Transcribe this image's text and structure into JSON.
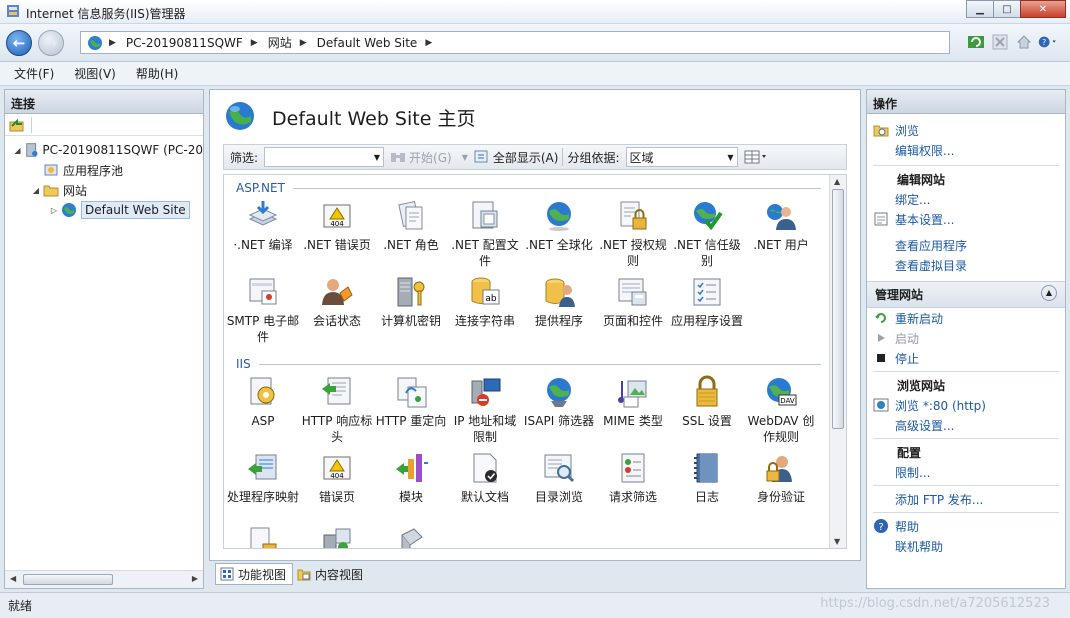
{
  "window": {
    "title": "Internet 信息服务(IIS)管理器"
  },
  "address": {
    "crumbs": [
      "PC-20190811SQWF",
      "网站",
      "Default Web Site"
    ]
  },
  "menu": {
    "file": "文件(F)",
    "view": "视图(V)",
    "help": "帮助(H)"
  },
  "connections": {
    "header": "连接",
    "tree": [
      {
        "label": "PC-20190811SQWF (PC-20",
        "expander": "◢"
      },
      {
        "label": "应用程序池",
        "expander": ""
      },
      {
        "label": "网站",
        "expander": "◢"
      },
      {
        "label": "Default Web Site",
        "expander": "▷"
      }
    ]
  },
  "main": {
    "title": "Default Web Site 主页",
    "filter": {
      "label": "筛选:",
      "start": "开始(G)",
      "show_all": "全部显示(A)",
      "group_by_label": "分组依据:",
      "group_by_value": "区域"
    },
    "groups": [
      {
        "name": "ASP.NET",
        "rows": [
          [
            "·.NET 编译",
            ".NET 错误页",
            ".NET 角色",
            ".NET 配置文件",
            ".NET 全球化",
            ".NET 授权规则",
            ".NET 信任级别",
            ".NET 用户"
          ],
          [
            "SMTP 电子邮件",
            "会话状态",
            "计算机密钥",
            "连接字符串",
            "提供程序",
            "页面和控件",
            "应用程序设置"
          ]
        ]
      },
      {
        "name": "IIS",
        "rows": [
          [
            "ASP",
            "HTTP 响应标头",
            "HTTP 重定向",
            "IP 地址和域限制",
            "ISAPI 筛选器",
            "MIME 类型",
            "SSL 设置",
            "WebDAV 创作规则"
          ],
          [
            "处理程序映射",
            "错误页",
            "模块",
            "默认文档",
            "目录浏览",
            "请求筛选",
            "日志",
            "身份验证"
          ]
        ]
      }
    ],
    "view_tabs": {
      "features": "功能视图",
      "content": "内容视图"
    }
  },
  "actions": {
    "header": "操作",
    "browse": "浏览",
    "edit_permissions": "编辑权限...",
    "edit_site_title": "编辑网站",
    "bindings": "绑定...",
    "basic_settings": "基本设置...",
    "view_apps": "查看应用程序",
    "view_vdirs": "查看虚拟目录",
    "manage_site_title": "管理网站",
    "restart": "重新启动",
    "start": "启动",
    "stop": "停止",
    "browse_site_title": "浏览网站",
    "browse_port": "浏览 *:80 (http)",
    "advanced_settings": "高级设置...",
    "config_title": "配置",
    "limits": "限制...",
    "add_ftp": "添加 FTP 发布...",
    "help": "帮助",
    "online_help": "联机帮助"
  },
  "status": {
    "text": "就绪"
  },
  "watermark": "https://blog.csdn.net/a7205612523"
}
